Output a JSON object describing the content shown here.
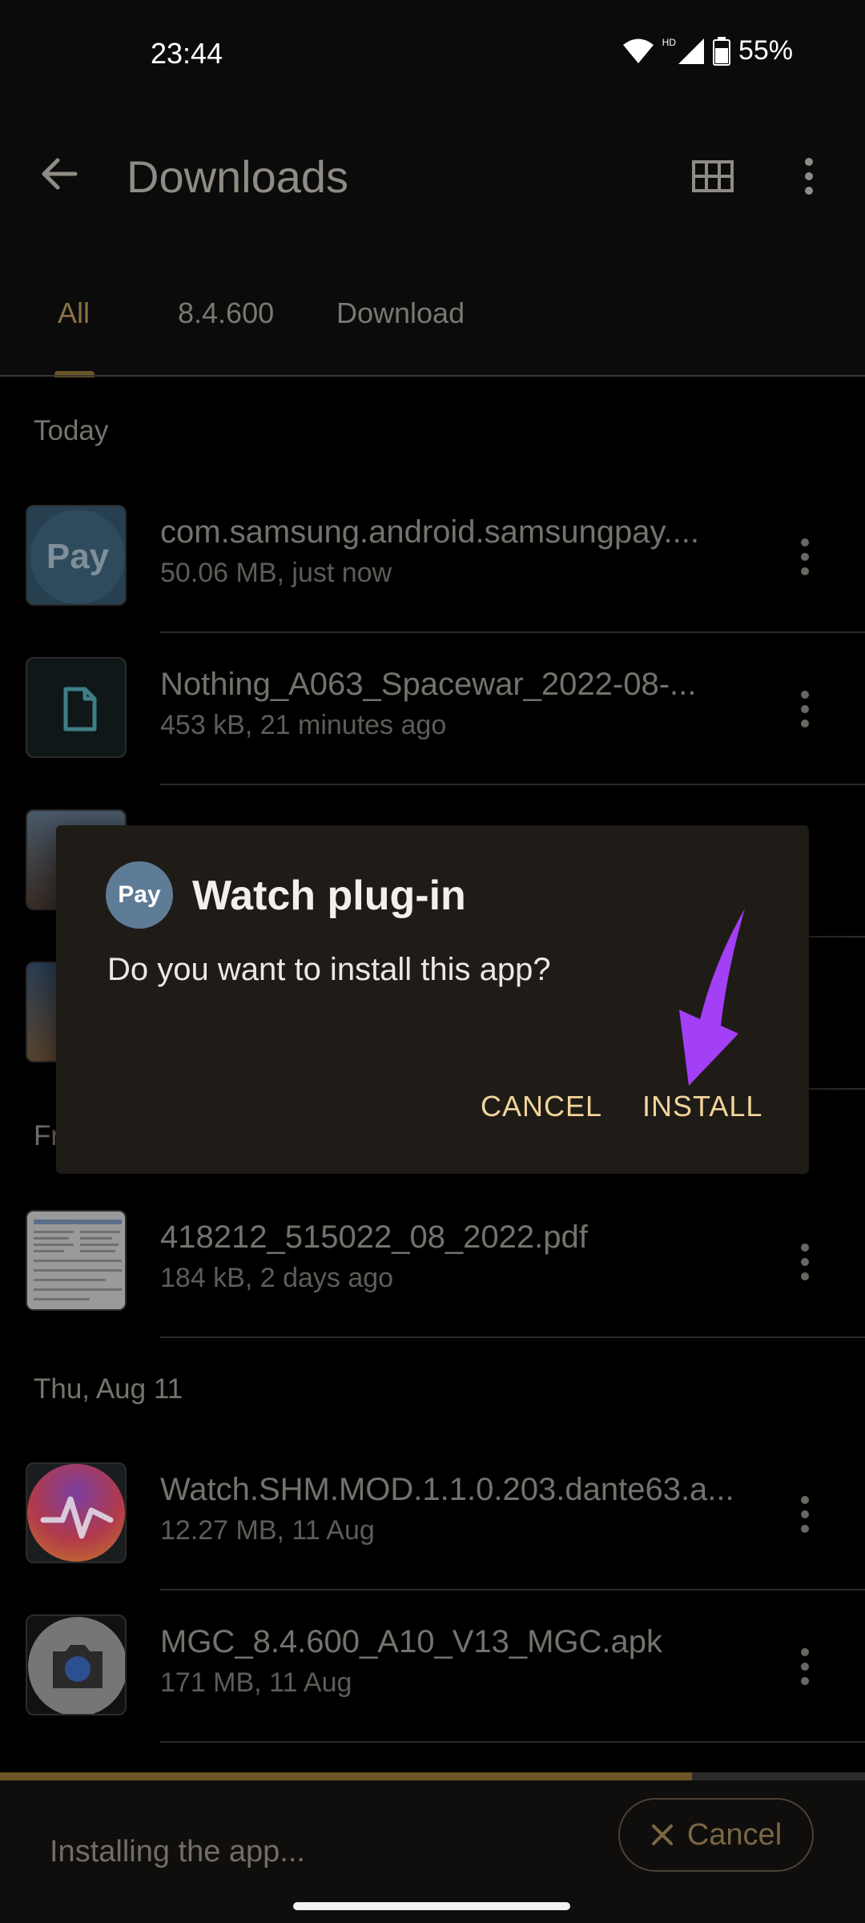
{
  "status_bar": {
    "time": "23:44",
    "network": "HD",
    "battery": "55%"
  },
  "app_bar": {
    "title": "Downloads"
  },
  "tabs": [
    {
      "label": "All",
      "active": true
    },
    {
      "label": "8.4.600",
      "active": false
    },
    {
      "label": "Download",
      "active": false
    }
  ],
  "sections": {
    "today": "Today",
    "fri": "Fr",
    "thu": "Thu, Aug 11"
  },
  "files": [
    {
      "name": "com.samsung.android.samsungpay....",
      "meta": "50.06 MB, just now",
      "icon": "pay-icon"
    },
    {
      "name": "Nothing_A063_Spacewar_2022-08-...",
      "meta": "453 kB, 21 minutes ago",
      "icon": "document-icon"
    },
    {
      "name": "418212_515022_08_2022.pdf",
      "meta": "184 kB, 2 days ago",
      "icon": "pdf-thumbnail"
    },
    {
      "name": "Watch.SHM.MOD.1.1.0.203.dante63.a...",
      "meta": "12.27 MB, 11 Aug",
      "icon": "health-app-icon"
    },
    {
      "name": "MGC_8.4.600_A10_V13_MGC.apk",
      "meta": "171 MB, 11 Aug",
      "icon": "camera-app-icon"
    }
  ],
  "dialog": {
    "icon_text": "Pay",
    "title": "Watch plug-in",
    "message": "Do you want to install this app?",
    "cancel_label": "CANCEL",
    "install_label": "INSTALL"
  },
  "bottom_bar": {
    "status": "Installing the app...",
    "cancel_label": "Cancel",
    "progress": 0.8
  },
  "colors": {
    "accent": "#f2d49a",
    "arrow": "#a33ff5"
  },
  "thumb_text": {
    "pay": "Pay"
  }
}
